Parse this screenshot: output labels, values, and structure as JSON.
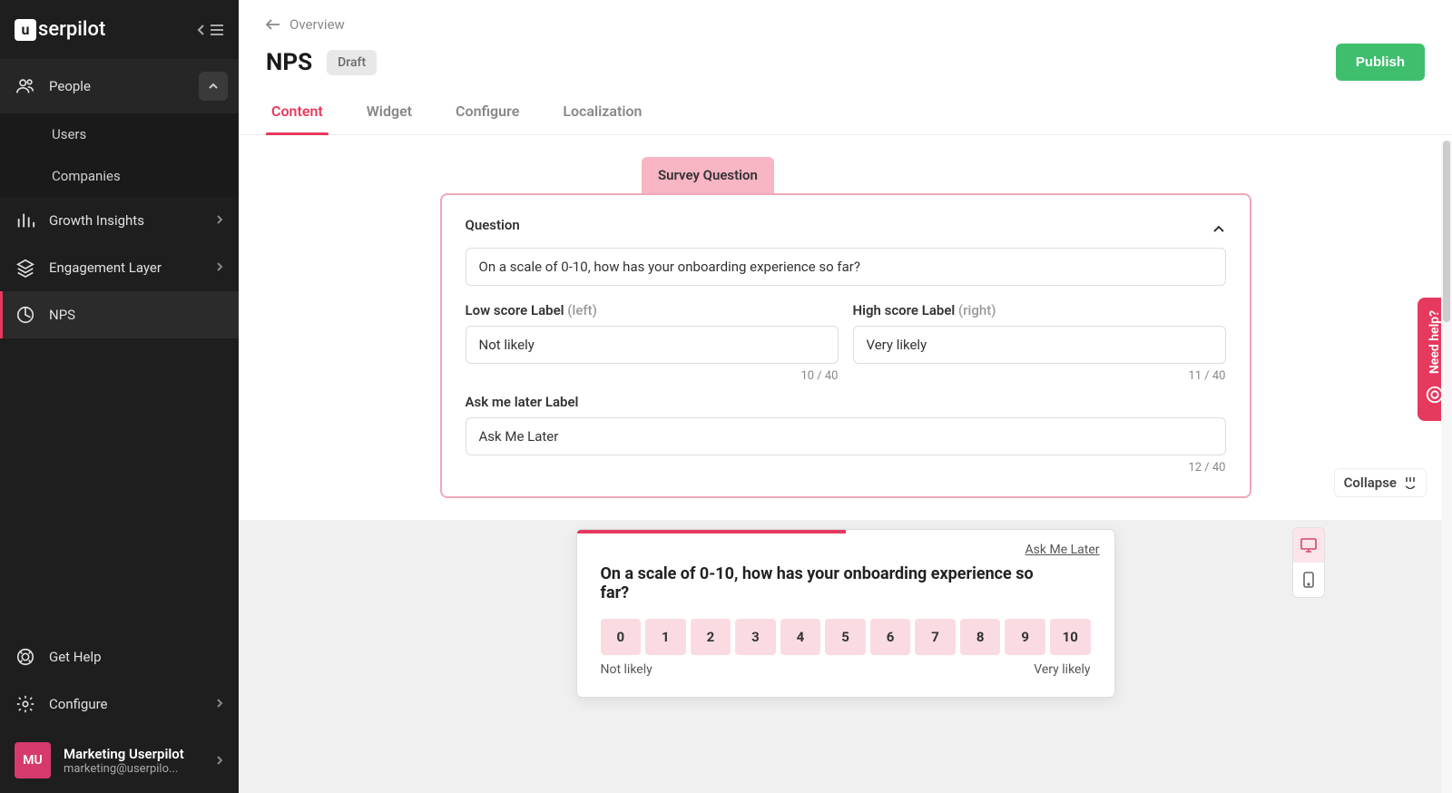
{
  "logo": "serpilot",
  "sidebar": {
    "items": [
      {
        "label": "People"
      },
      {
        "label": "Users"
      },
      {
        "label": "Companies"
      },
      {
        "label": "Growth Insights"
      },
      {
        "label": "Engagement Layer"
      },
      {
        "label": "NPS"
      }
    ],
    "getHelp": "Get Help",
    "configure": "Configure"
  },
  "profile": {
    "initials": "MU",
    "name": "Marketing Userpilot",
    "email": "marketing@userpilo..."
  },
  "breadcrumb": "Overview",
  "title": "NPS",
  "status": "Draft",
  "publish": "Publish",
  "tabs": [
    "Content",
    "Widget",
    "Configure",
    "Localization"
  ],
  "surveyTab": "Survey Question",
  "form": {
    "questionLabel": "Question",
    "questionValue": "On a scale of 0-10, how has your onboarding experience so far?",
    "lowLabel": "Low score Label",
    "lowHint": "(left)",
    "lowValue": "Not likely",
    "lowCount": "10 / 40",
    "highLabel": "High score Label",
    "highHint": "(right)",
    "highValue": "Very likely",
    "highCount": "11 / 40",
    "askLaterLabel": "Ask me later Label",
    "askLaterValue": "Ask Me Later",
    "askLaterCount": "12 / 40"
  },
  "collapse": "Collapse",
  "preview": {
    "askLater": "Ask Me Later",
    "question": "On a scale of 0-10, how has your onboarding experience so far?",
    "scale": [
      "0",
      "1",
      "2",
      "3",
      "4",
      "5",
      "6",
      "7",
      "8",
      "9",
      "10"
    ],
    "low": "Not likely",
    "high": "Very likely"
  },
  "helpTab": "Need help?"
}
